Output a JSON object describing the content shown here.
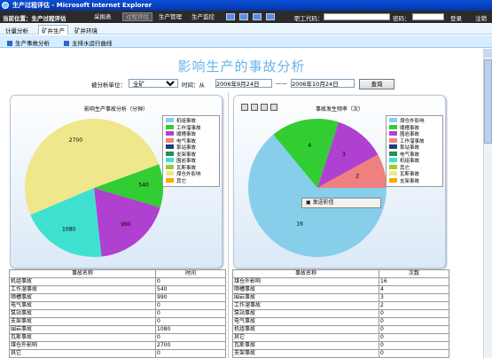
{
  "window": {
    "title": "生产过程评估 - Microsoft Internet Explorer"
  },
  "toolbar": {
    "location_label": "当前位置：生产过程评估",
    "buttons": [
      "采掘表",
      "过程评估",
      "生产管理",
      "生产监控"
    ],
    "employee_label": "职工代码：",
    "employee_value": "",
    "password_label": "密码：",
    "password_value": "",
    "login": "登录",
    "logout": "注销"
  },
  "nav": {
    "tabs": [
      "计量分析",
      "矿井生产",
      "矿井环境"
    ],
    "active_tab": "矿井生产"
  },
  "subnav": {
    "items": [
      "生产事故分析",
      "主排水运行曲线"
    ]
  },
  "page_title": "影响生产的事故分析",
  "filter": {
    "unit_label": "被分析单位：",
    "unit_value": "全矿",
    "time_label": "时间：从",
    "from_date": "2006年9月24日",
    "separator": "——",
    "to_date": "2006年10月24日",
    "query_button": "查询"
  },
  "colors": {
    "skyblue": "#87CEEB",
    "green": "#32CD32",
    "purple": "#B040D0",
    "salmon": "#F08080",
    "teal": "#40E0D0",
    "khaki": "#F0E68C",
    "navy": "#1F3F7F",
    "darkgreen": "#2E8B57",
    "olive": "#9ACD32",
    "orange": "#FFA500",
    "pink": "#FF69B4"
  },
  "left_chart": {
    "title": "影响生产事故分析（分钟）",
    "legend": [
      "机组事故",
      "工作溜事故",
      "顺槽事故",
      "电气事故",
      "泵站事故",
      "支架事故",
      "围岩事故",
      "瓦斯事故",
      "煤仓外影响",
      "其它"
    ],
    "legend_colors": [
      "#87CEEB",
      "#32CD32",
      "#B040D0",
      "#F08080",
      "#1F3F7F",
      "#2E8B57",
      "#40E0D0",
      "#9ACD32",
      "#F0E68C",
      "#FFA500"
    ]
  },
  "right_chart": {
    "title": "事故发生频率（次）",
    "legend": [
      "煤仓外影响",
      "顺槽事故",
      "围岩事故",
      "工作溜事故",
      "泵站事故",
      "电气事故",
      "机组事故",
      "其它",
      "瓦斯事故",
      "支架事故"
    ],
    "legend_colors": [
      "#87CEEB",
      "#32CD32",
      "#B040D0",
      "#F08080",
      "#1F3F7F",
      "#2E8B57",
      "#40E0D0",
      "#9ACD32",
      "#F0E68C",
      "#FFA500"
    ],
    "popup_label": "发送彩信"
  },
  "chart_data": [
    {
      "type": "pie",
      "title": "影响生产事故分析（分钟）",
      "categories": [
        "工作溜事故",
        "顺槽事故",
        "围岩事故",
        "煤仓外影响"
      ],
      "values": [
        540,
        990,
        1080,
        2700
      ],
      "colors": [
        "#32CD32",
        "#B040D0",
        "#40E0D0",
        "#F0E68C"
      ]
    },
    {
      "type": "pie",
      "title": "事故发生频率（次）",
      "categories": [
        "煤仓外影响",
        "顺槽事故",
        "围岩事故",
        "工作溜事故"
      ],
      "values": [
        16,
        4,
        3,
        2
      ],
      "colors": [
        "#87CEEB",
        "#32CD32",
        "#B040D0",
        "#F08080"
      ]
    }
  ],
  "left_table": {
    "headers": [
      "事故名称",
      "时间"
    ],
    "rows": [
      [
        "机组事故",
        "0"
      ],
      [
        "工作溜事故",
        "540"
      ],
      [
        "顺槽事故",
        "990"
      ],
      [
        "电气事故",
        "0"
      ],
      [
        "泵站事故",
        "0"
      ],
      [
        "支架事故",
        "0"
      ],
      [
        "围岩事故",
        "1080"
      ],
      [
        "瓦斯事故",
        "0"
      ],
      [
        "煤仓外影响",
        "2700"
      ],
      [
        "其它",
        "0"
      ]
    ]
  },
  "right_table": {
    "headers": [
      "事故名称",
      "次数"
    ],
    "rows": [
      [
        "煤仓外影响",
        "16"
      ],
      [
        "顺槽事故",
        "4"
      ],
      [
        "围岩事故",
        "3"
      ],
      [
        "工作溜事故",
        "2"
      ],
      [
        "泵站事故",
        "0"
      ],
      [
        "电气事故",
        "0"
      ],
      [
        "机组事故",
        "0"
      ],
      [
        "其它",
        "0"
      ],
      [
        "瓦斯事故",
        "0"
      ],
      [
        "支架事故",
        "0"
      ]
    ]
  }
}
